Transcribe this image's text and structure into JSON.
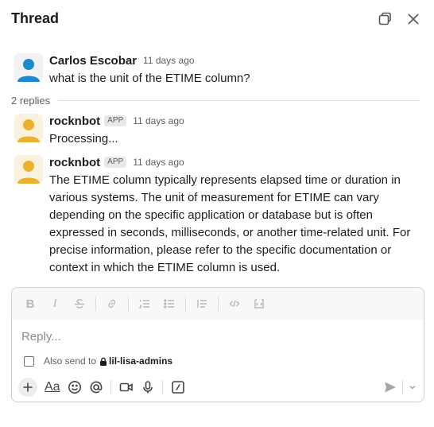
{
  "header": {
    "title": "Thread"
  },
  "parent_message": {
    "author": "Carlos Escobar",
    "time": "11 days ago",
    "text": "what is the unit of the ETIME column?",
    "avatar_color": "#1d89cf"
  },
  "replies": {
    "count_label": "2 replies"
  },
  "messages": [
    {
      "author": "rocknbot",
      "badge": "APP",
      "time": "11 days ago",
      "text": "Processing...",
      "avatar_color": "#ecb22e"
    },
    {
      "author": "rocknbot",
      "badge": "APP",
      "time": "11 days ago",
      "text": "The ETIME column typically represents elapsed time or duration in various systems. The unit of measurement for ETIME can vary depending on the specific application or database but is often expressed in seconds, milliseconds, or another time-related unit. For precise information, please refer to the specific documentation or context in which the ETIME column is used.",
      "avatar_color": "#ecb22e"
    }
  ],
  "composer": {
    "placeholder": "Reply...",
    "also_send_label": "Also send to",
    "channel": "lil-lisa-admins",
    "format_label": "Aa"
  }
}
